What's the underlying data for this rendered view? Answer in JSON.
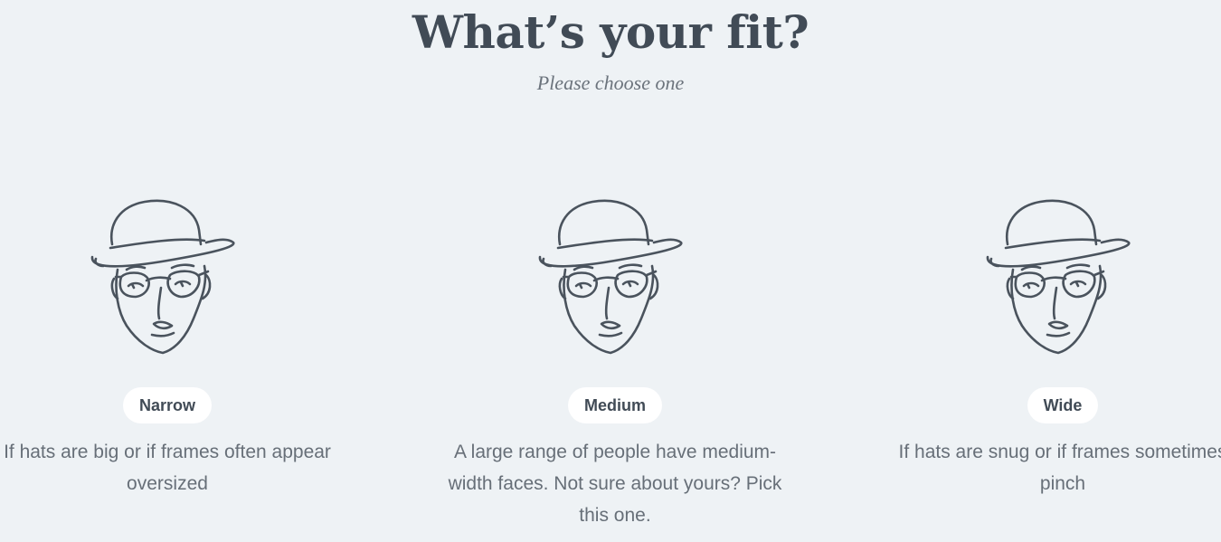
{
  "header": {
    "title": "What’s your fit?",
    "subtitle": "Please choose one"
  },
  "options": [
    {
      "label": "Narrow",
      "description": "If hats are big or if frames often appear oversized",
      "icon": "face-with-hat-and-glasses-icon"
    },
    {
      "label": "Medium",
      "description": "A large range of people have medium-width faces. Not sure about yours? Pick this one.",
      "icon": "face-with-hat-and-glasses-icon"
    },
    {
      "label": "Wide",
      "description": "If hats are snug or if frames sometimes pinch",
      "icon": "face-with-hat-and-glasses-icon"
    }
  ],
  "colors": {
    "background": "#eef2f5",
    "text_primary": "#414b56",
    "text_secondary": "#676f78",
    "pill_background": "#ffffff"
  }
}
